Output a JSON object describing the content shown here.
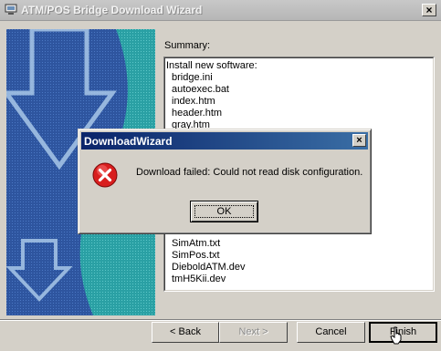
{
  "window": {
    "title": "ATM/POS Bridge Download Wizard",
    "close_glyph": "×",
    "icon": "computer-icon"
  },
  "summary": {
    "label": "Summary:",
    "heading": "Install new software:",
    "files_top": [
      "bridge.ini",
      "autoexec.bat",
      "index.htm",
      "header.htm",
      "gray.htm"
    ],
    "files_bottom": [
      "SimAtm.txt",
      "SimPos.txt",
      "DieboldATM.dev",
      "tmH5Kii.dev"
    ]
  },
  "buttons": {
    "back": "< Back",
    "next": "Next >",
    "cancel": "Cancel",
    "finish": "Finish"
  },
  "dialog": {
    "title": "DownloadWizard",
    "close_glyph": "×",
    "message": "Download failed: Could not read disk configuration.",
    "ok": "OK",
    "icon": "error-icon"
  },
  "colors": {
    "dialog_title_start": "#0a246a",
    "dialog_title_end": "#3a6ea5",
    "error_red": "#d81e1e",
    "banner_blue": "#2a4f97",
    "banner_teal": "#2aa8a4"
  }
}
